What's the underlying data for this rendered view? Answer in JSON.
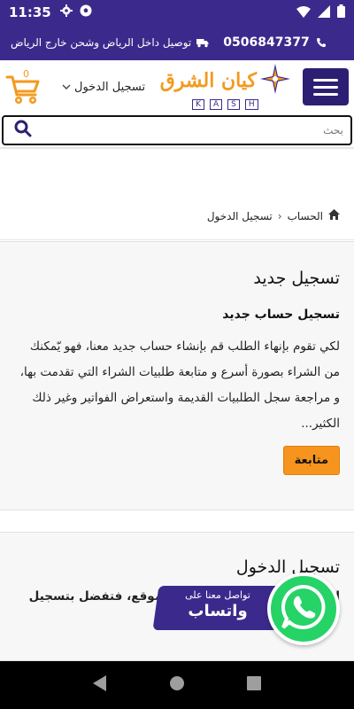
{
  "status_bar": {
    "time": "11:35"
  },
  "info_bar": {
    "phone": "0506847377",
    "delivery_text": "توصيل داخل الرياض وشحن خارج الرياض"
  },
  "header": {
    "cart_count": "0",
    "login_label": "تسجيل الدخول",
    "logo": {
      "arabic_text": "كيان الشرق",
      "latin_letters": [
        "K",
        "A",
        "S",
        "H"
      ]
    }
  },
  "search": {
    "placeholder": "بحث"
  },
  "breadcrumb": {
    "items": [
      "الحساب",
      "تسجيل الدخول"
    ]
  },
  "register": {
    "title": "تسجيل جديد",
    "subtitle": "تسجيل حساب جديد",
    "body": "لكي تقوم بإنهاء الطلب قم بإنشاء حساب جديد معنا، فهو يّمكنك من الشراء بصورة أسرع و متابعة طلبيات الشراء التي تقدمت بها، و مراجعة سجل الطلبيات القديمة واستعراض الفواتير وغير ذلك الكثير...",
    "button_label": "متابعة"
  },
  "login": {
    "title": "تسجيل الدخول",
    "body": "إذا كان لديك حساب معنا في الموقع، فتفضل بتسجيل دخول"
  },
  "whatsapp": {
    "line1": "تواصل معنا على",
    "line2": "واتساب"
  },
  "colors": {
    "brand_purple": "#3b2a8c",
    "accent_orange": "#f7941d",
    "whatsapp_green": "#25d366"
  }
}
